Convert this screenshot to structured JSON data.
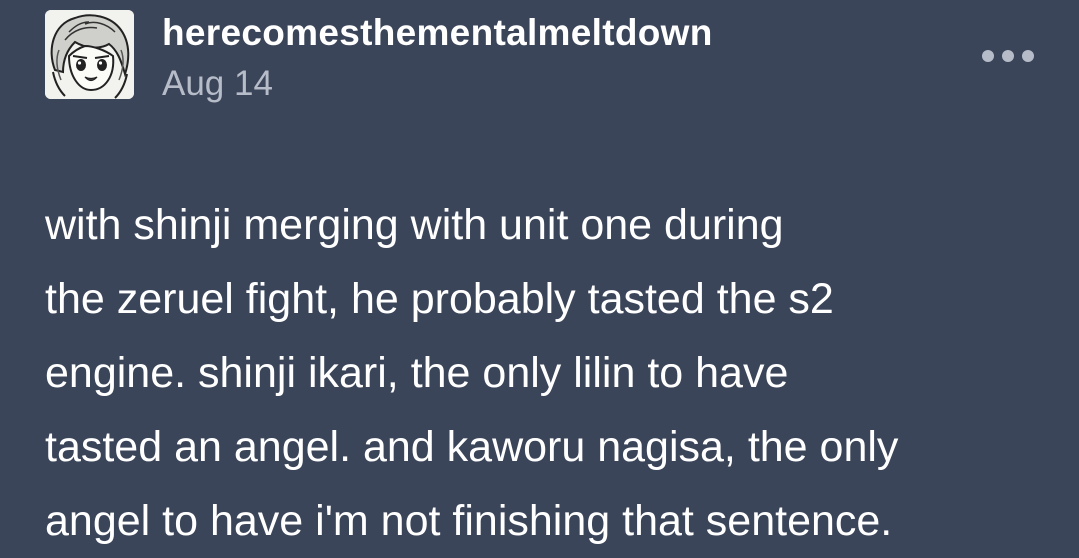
{
  "post": {
    "author": "herecomesthementalmeltdown",
    "date": "Aug 14",
    "avatar_icon": "anime-character-avatar",
    "more_icon": "ellipsis-icon",
    "body_lines": [
      "with shinji merging with unit one during",
      "the zeruel fight, he probably tasted the s2",
      "engine. shinji ikari, the only lilin to have",
      "tasted an angel. and kaworu nagisa, the only",
      "angel to have i'm not finishing that sentence."
    ]
  },
  "colors": {
    "background": "#3b4559",
    "text": "#ffffff",
    "muted": "#b6bcc8"
  }
}
